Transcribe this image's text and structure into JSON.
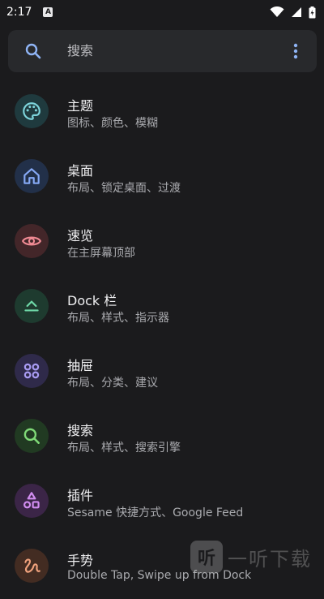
{
  "status_bar": {
    "time": "2:17",
    "notification_letter": "A"
  },
  "search": {
    "placeholder": "搜索"
  },
  "items": [
    {
      "title": "主题",
      "subtitle": "图标、颜色、模糊",
      "icon": "palette-icon",
      "icon_color": "#7dd3da",
      "bg_color": "#1f3a3e"
    },
    {
      "title": "桌面",
      "subtitle": "布局、锁定桌面、过渡",
      "icon": "home-icon",
      "icon_color": "#86a9f5",
      "bg_color": "#223049"
    },
    {
      "title": "速览",
      "subtitle": "在主屏幕顶部",
      "icon": "eye-icon",
      "icon_color": "#ef8a93",
      "bg_color": "#432629"
    },
    {
      "title": "Dock 栏",
      "subtitle": "布局、样式、指示器",
      "icon": "dock-icon",
      "icon_color": "#6fd9a8",
      "bg_color": "#1e3b2f"
    },
    {
      "title": "抽屉",
      "subtitle": "布局、分类、建议",
      "icon": "apps-grid-icon",
      "icon_color": "#a99cf3",
      "bg_color": "#2f2a4a"
    },
    {
      "title": "搜索",
      "subtitle": "布局、样式、搜索引擎",
      "icon": "search-icon",
      "icon_color": "#7fd977",
      "bg_color": "#213a22"
    },
    {
      "title": "插件",
      "subtitle": "Sesame 快捷方式、Google Feed",
      "icon": "widgets-icon",
      "icon_color": "#d18df0",
      "bg_color": "#3b2547"
    },
    {
      "title": "手势",
      "subtitle": "Double Tap, Swipe up from Dock",
      "icon": "gesture-icon",
      "icon_color": "#f0a27d",
      "bg_color": "#432c22"
    }
  ],
  "watermark": {
    "text": "一听下载"
  }
}
